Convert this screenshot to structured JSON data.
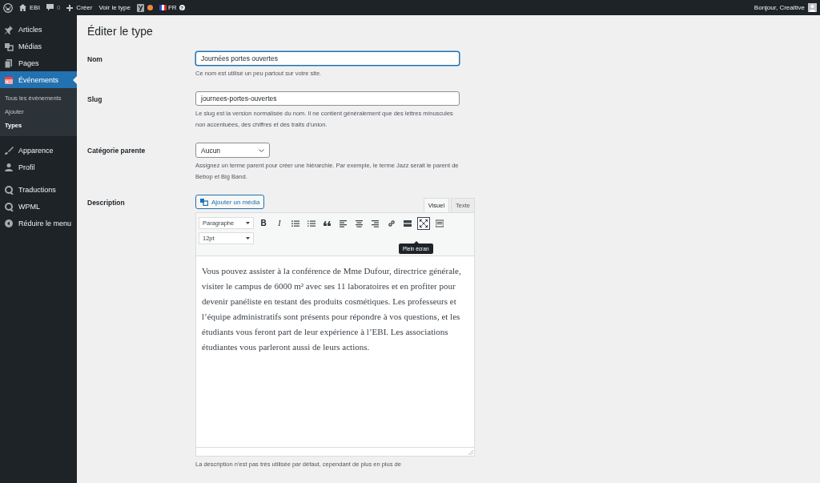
{
  "admin_bar": {
    "site": "EBI",
    "comments": "0",
    "new": "Créer",
    "view": "Voir le type",
    "language": "FR",
    "help": "?",
    "greeting": "Bonjour, Crealtive"
  },
  "sidebar": {
    "items": [
      {
        "label": "Articles",
        "selected": false
      },
      {
        "label": "Médias",
        "selected": false
      },
      {
        "label": "Pages",
        "selected": false
      },
      {
        "label": "Événements",
        "selected": true,
        "children": [
          {
            "label": "Tous les événements",
            "selected": false
          },
          {
            "label": "Ajouter",
            "selected": false
          },
          {
            "label": "Types",
            "selected": true
          }
        ]
      },
      {
        "label": "Apparence",
        "selected": false
      },
      {
        "label": "Profil",
        "selected": false
      },
      {
        "label": "Traductions",
        "selected": false
      },
      {
        "label": "WPML",
        "selected": false
      },
      {
        "label": "Réduire le menu",
        "selected": false
      }
    ]
  },
  "page": {
    "title": "Éditer le type",
    "fields": [
      {
        "kind": "text",
        "label": "Nom",
        "value": "Journées portes ouvertes",
        "focused": true,
        "help": "Ce nom est utilisé un peu partout sur votre site."
      },
      {
        "kind": "text",
        "label": "Slug",
        "value": "journees-portes-ouvertes",
        "focused": false,
        "help": "Le slug est la version normalisée du nom. Il ne contient généralement que des lettres minuscules non accentuées, des chiffres et des traits d’union."
      },
      {
        "kind": "select",
        "label": "Catégorie parente",
        "value": "Aucun",
        "help": "Assignez un terme parent pour créer une hiérarchie. Par exemple, le terme Jazz serait le parent de Bebop et Big Band."
      },
      {
        "kind": "editor",
        "label": "Description",
        "media_button": "Ajouter un média",
        "tabs": [
          {
            "label": "Visuel",
            "selected": true
          },
          {
            "label": "Texte",
            "selected": false
          }
        ],
        "format": "Paragraphe",
        "size": "12pt",
        "bold": "B",
        "italic": "I",
        "tooltip": "Plein écran",
        "content": "Vous pouvez assister à la conférence de Mme Dufour, directrice générale, visiter le campus de 6000 m² avec ses 11 laboratoires et en profiter pour devenir panéliste en testant des produits cosmétiques. Les professeurs et l’équipe administratifs sont présents pour répondre à vos questions, et les étudiants vous feront part de leur expérience à l’EBI. Les associations étudiantes vous parleront aussi de leurs actions.",
        "help": "La description n’est pas très utilisée par défaut, cependant de plus en plus de"
      }
    ]
  }
}
